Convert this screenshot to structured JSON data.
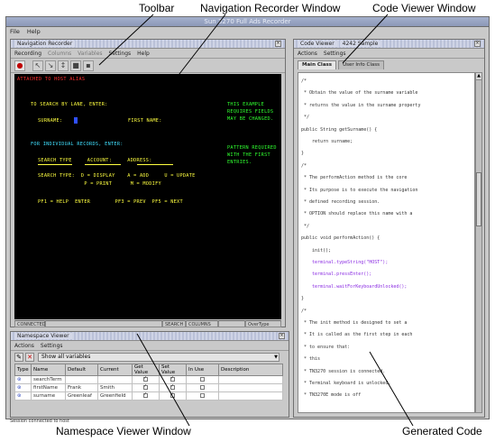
{
  "callouts": {
    "toolbar": "Toolbar",
    "navigation_recorder": "Navigation Recorder Window",
    "code_viewer": "Code Viewer Window",
    "namespace_viewer": "Namespace Viewer Window",
    "generated_code": "Generated Code"
  },
  "app": {
    "title": "Sun 3270 Full Ads Recorder",
    "menu": [
      "File",
      "Help"
    ]
  },
  "recorder": {
    "title": "Navigation Recorder",
    "menu": [
      "Recording",
      "Columns",
      "Variables",
      "Settings",
      "Help"
    ],
    "toolbar_icons": [
      "record-icon",
      "pointer-icon",
      "arrow-icon",
      "arrow-alt-icon",
      "stop-icon",
      "clear-icon"
    ],
    "terminal_lines": [
      {
        "text": "ATTACHED TO HOST ALIAS",
        "color": "red"
      },
      {
        "text": "TO SEARCH BY LANE, ENTER:",
        "color": "yel"
      },
      {
        "text": "THIS EXAMPLE",
        "color": "grn"
      },
      {
        "text": "REQUIRES FIELDS",
        "color": "grn"
      },
      {
        "text": "MAY BE CHANGED.",
        "color": "grn"
      },
      {
        "text": "SURNAME:",
        "color": "yel"
      },
      {
        "text": "FIRST NAME:",
        "color": "yel"
      },
      {
        "text": "FOR INDIVIDUAL RECORDS, ENTER:",
        "color": "cyan"
      },
      {
        "text": "PATTERN REQUIRED",
        "color": "grn"
      },
      {
        "text": "WITH THE FIRST",
        "color": "grn"
      },
      {
        "text": "ENTRIES.",
        "color": "grn"
      },
      {
        "text": "SEARCH TYPE     ACCOUNT:     ADDRESS:",
        "color": "yel"
      },
      {
        "text": "SEARCH TYPE:  D = DISPLAY    A = ADD     U = UPDATE",
        "color": "yel"
      },
      {
        "text": "               P = PRINT      M = MODIFY",
        "color": "yel"
      },
      {
        "text": "PF1 = HELP  ENTER        PF3 = PREV  PF5 = NEXT",
        "color": "yel"
      }
    ],
    "status": [
      "CONNECTED",
      "SEARCH",
      "COLUMNS",
      "OverType"
    ]
  },
  "code_viewer": {
    "title": "Code Viewer",
    "file": "4242 Sample",
    "menu": [
      "Actions",
      "Settings"
    ],
    "tabs": [
      "Main Class",
      "User Info Class"
    ],
    "active_tab": 0,
    "lines": [
      {
        "t": "/*",
        "c": ""
      },
      {
        "t": " * Obtain the value of the surname variable",
        "c": ""
      },
      {
        "t": " * returns the value in the surname property",
        "c": ""
      },
      {
        "t": " */",
        "c": ""
      },
      {
        "t": "public String getSurname() {",
        "c": ""
      },
      {
        "t": "    return surname;",
        "c": ""
      },
      {
        "t": "}",
        "c": ""
      },
      {
        "t": "/*",
        "c": ""
      },
      {
        "t": " * The performAction method is the core",
        "c": ""
      },
      {
        "t": " * Its purpose is to execute the navigation",
        "c": ""
      },
      {
        "t": " * defined recording session.",
        "c": ""
      },
      {
        "t": " * OPTION should replace this name with a",
        "c": ""
      },
      {
        "t": " */",
        "c": ""
      },
      {
        "t": "public void performAction() {",
        "c": ""
      },
      {
        "t": "    init();",
        "c": ""
      },
      {
        "t": "    terminal.typeString(\"HOST\");",
        "c": "purple"
      },
      {
        "t": "    terminal.pressEnter();",
        "c": "purple"
      },
      {
        "t": "    terminal.waitForKeyboardUnlocked();",
        "c": "purple"
      },
      {
        "t": "}",
        "c": ""
      },
      {
        "t": "/*",
        "c": ""
      },
      {
        "t": " * The init method is designed to set a",
        "c": ""
      },
      {
        "t": " * It is called as the first step in each",
        "c": ""
      },
      {
        "t": " * to ensure that:",
        "c": ""
      },
      {
        "t": " * this",
        "c": ""
      },
      {
        "t": " * TN3270 session is connected.",
        "c": ""
      },
      {
        "t": " * Terminal keyboard is unlocked.",
        "c": ""
      },
      {
        "t": " * TN3270E mode is off",
        "c": ""
      }
    ]
  },
  "namespace": {
    "title": "Namespace Viewer",
    "menu": [
      "Actions",
      "Settings"
    ],
    "filter": "Show all variables",
    "columns": [
      "Type",
      "Name",
      "Default",
      "Current",
      "Get Value",
      "Set Value",
      "In Use",
      "Description"
    ],
    "rows": [
      {
        "name": "searchTerm",
        "default": "",
        "current": "",
        "get": true,
        "set": true,
        "inuse": false,
        "desc": ""
      },
      {
        "name": "firstName",
        "default": "Frank",
        "current": "Smith",
        "get": true,
        "set": true,
        "inuse": false,
        "desc": ""
      },
      {
        "name": "surname",
        "default": "Greenleaf",
        "current": "Greenfield",
        "get": true,
        "set": true,
        "inuse": false,
        "desc": ""
      }
    ],
    "status": "Session connected to host"
  }
}
